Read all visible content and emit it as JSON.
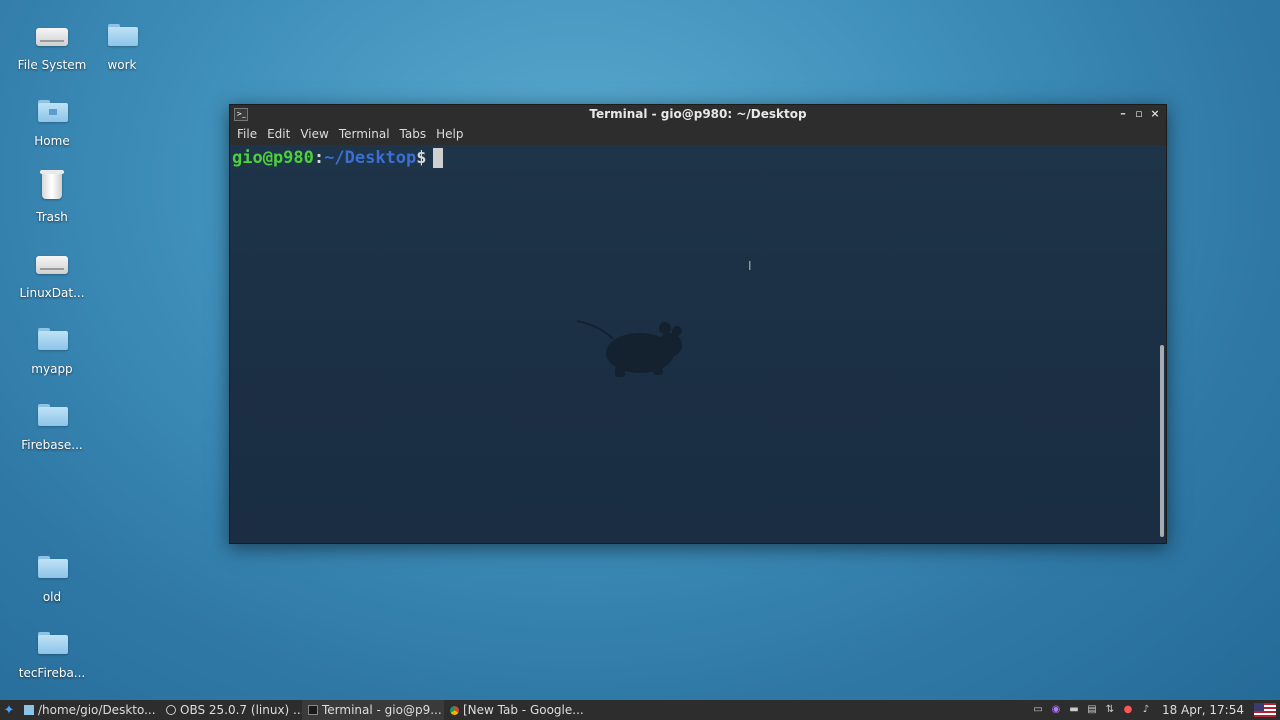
{
  "desktop": {
    "icons": [
      {
        "label": "File System",
        "type": "drive"
      },
      {
        "label": "work",
        "type": "folder"
      },
      {
        "label": "Home",
        "type": "folder-home"
      },
      {
        "label": "Trash",
        "type": "trash"
      },
      {
        "label": "LinuxDat...",
        "type": "drive"
      },
      {
        "label": "myapp",
        "type": "folder"
      },
      {
        "label": "Firebase...",
        "type": "folder"
      },
      {
        "label": "old",
        "type": "folder"
      },
      {
        "label": "tecFireba...",
        "type": "folder"
      }
    ]
  },
  "terminal": {
    "title": "Terminal - gio@p980: ~/Desktop",
    "menu": [
      "File",
      "Edit",
      "View",
      "Terminal",
      "Tabs",
      "Help"
    ],
    "prompt": {
      "user_host": "gio@p980",
      "colon": ":",
      "path": "~/Desktop",
      "dollar": "$"
    },
    "controls": {
      "minimize": "–",
      "maximize": "▫",
      "close": "×"
    }
  },
  "taskbar": {
    "tasks": [
      {
        "label": "/home/gio/Deskto...",
        "icon": "file-manager-icon",
        "active": false
      },
      {
        "label": "OBS 25.0.7 (linux) ...",
        "icon": "obs-icon",
        "active": false
      },
      {
        "label": "Terminal - gio@p9...",
        "icon": "terminal-icon",
        "active": true
      },
      {
        "label": "[New Tab - Google...",
        "icon": "chrome-icon",
        "active": false
      }
    ],
    "clock": "18 Apr, 17:54"
  },
  "colors": {
    "prompt_user": "#4cd13b",
    "prompt_path": "#3b6fd4",
    "desktop_bg": "#3f90bb"
  }
}
